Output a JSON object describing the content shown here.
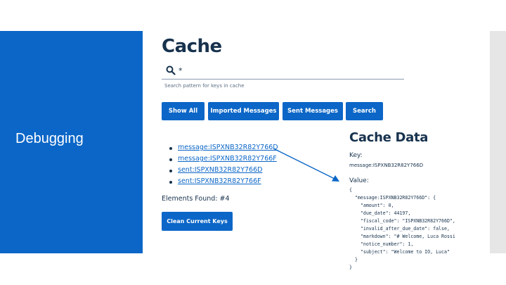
{
  "sidebar": {
    "title": "Debugging"
  },
  "page": {
    "title": "Cache"
  },
  "search": {
    "value": "*",
    "help": "Search pattern for keys in cache"
  },
  "buttons": [
    "Show All",
    "Imported Messages",
    "Sent Messages",
    "Search"
  ],
  "keys": [
    "message:ISPXNB32R82Y766D",
    "message:ISPXNB32R82Y766F",
    "sent:ISPXNB32R82Y766D",
    "sent:ISPXNB32R82Y766F"
  ],
  "found": "Elements Found: #4",
  "clean_button": "Clean Current Keys",
  "cache_data": {
    "title": "Cache Data",
    "key_label": "Key:",
    "key_value": "message:ISPXNB32R82Y766D",
    "value_label": "Value:",
    "json_text": "{\n  \"message:ISPXNB32R82Y766D\": {\n    \"amount\": 0,\n    \"due_date\": 44197,\n    \"fiscal_code\": \"ISPXNB32R82Y766D\",\n    \"invalid_after_due_date\": false,\n    \"markdown\": \"# Welcome, Luca Rossi\n    \"notice_number\": 1,\n    \"subject\": \"Welcome to IO, Luca\"\n  }\n}"
  },
  "colors": {
    "primary": "#0b66c7",
    "text": "#17324d",
    "panel_gray": "#e6e6e6"
  }
}
